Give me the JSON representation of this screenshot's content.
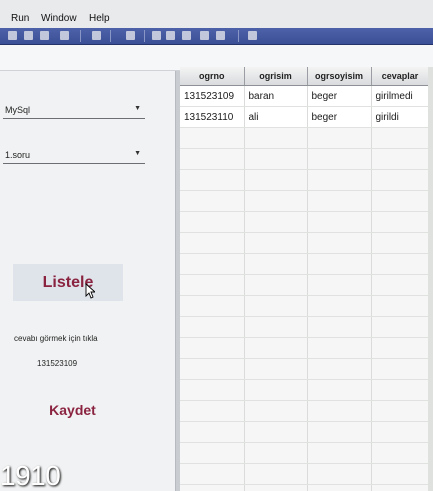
{
  "menu": {
    "items": [
      "Run",
      "Window",
      "Help"
    ]
  },
  "sidebar": {
    "db_combo": {
      "value": "MySql"
    },
    "question_combo": {
      "value": "1.soru"
    },
    "list_button": "Listele",
    "hint": "cevabı görmek için tıkla",
    "selected_id": "131523109",
    "save_button": "Kaydet"
  },
  "table": {
    "headers": [
      "ogrno",
      "ogrisim",
      "ogrsoyisim",
      "cevaplar"
    ],
    "rows": [
      [
        "131523109",
        "baran",
        "beger",
        "girilmedi"
      ],
      [
        "131523110",
        "ali",
        "beger",
        "girildi"
      ]
    ]
  },
  "overlay": {
    "frame_number": "1910"
  },
  "colors": {
    "button_text": "#8a2340",
    "toolbar": "#4d62a8"
  }
}
